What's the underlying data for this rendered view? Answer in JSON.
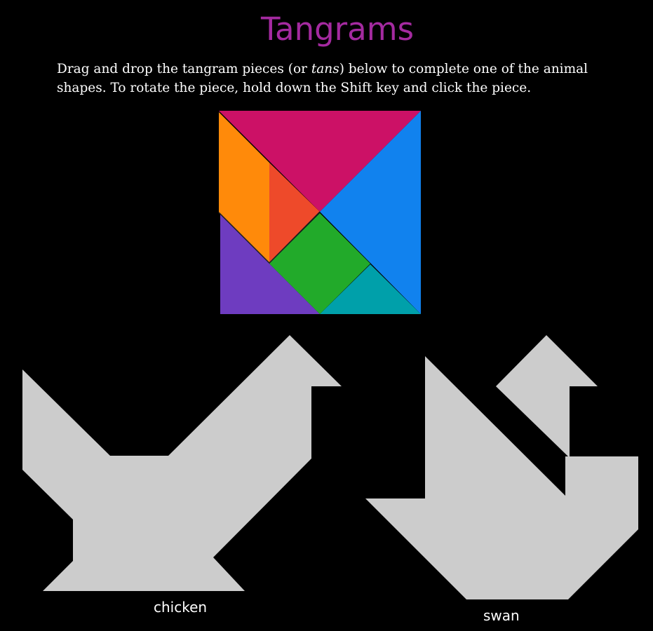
{
  "page": {
    "title": "Tangrams",
    "instructions": {
      "part1": "Drag and drop the tangram pieces (or ",
      "emphasis": "tans",
      "part2": ") below to complete one of the animal shapes. To rotate the piece, hold down the Shift key and click the piece."
    }
  },
  "tans": [
    {
      "name": "large-triangle-top",
      "color": "#cc1166"
    },
    {
      "name": "large-triangle-right",
      "color": "#1182ee"
    },
    {
      "name": "parallelogram",
      "color": "#ff8a0a"
    },
    {
      "name": "small-triangle-center",
      "color": "#ee4a2a"
    },
    {
      "name": "medium-triangle-bottom-left",
      "color": "#6e3cc0"
    },
    {
      "name": "square",
      "color": "#22aa2a"
    },
    {
      "name": "small-triangle-bottom-right",
      "color": "#00a0aa"
    }
  ],
  "targets": [
    {
      "label": "chicken",
      "fill": "#cccccc"
    },
    {
      "label": "swan",
      "fill": "#cccccc"
    }
  ],
  "colors": {
    "background": "#000000",
    "title": "#a42aa0",
    "text": "#ffffff",
    "silhouette": "#cccccc"
  }
}
